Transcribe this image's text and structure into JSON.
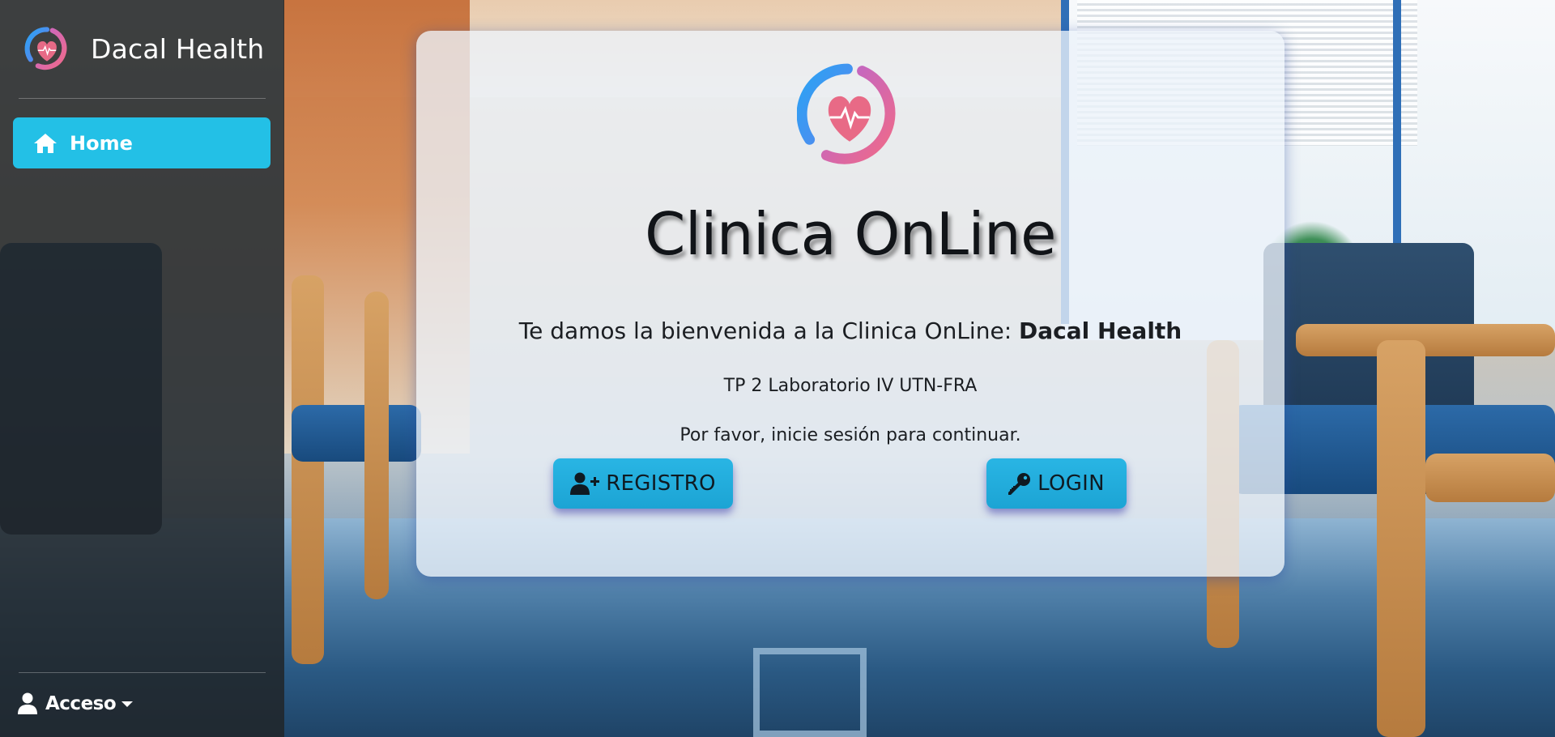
{
  "sidebar": {
    "brand_name": "Dacal Health",
    "nav": [
      {
        "label": "Home",
        "icon": "home-icon",
        "active": true
      }
    ],
    "account": {
      "label": "Acceso",
      "icon": "user-icon"
    }
  },
  "card": {
    "title": "Clinica OnLine",
    "welcome_prefix": "Te damos la bienvenida a la Clinica OnLine: ",
    "welcome_brand": "Dacal Health",
    "subtitle": "TP 2 Laboratorio IV UTN-FRA",
    "instruction": "Por favor, inicie sesión para continuar.",
    "buttons": {
      "register": {
        "label": "REGISTRO",
        "icon": "user-plus-icon"
      },
      "login": {
        "label": "LOGIN",
        "icon": "key-icon"
      }
    }
  },
  "colors": {
    "sidebar_bg": "#212529",
    "accent": "#23c0e6",
    "button_bg": "#1ca4d4",
    "logo_blue": "#2a9df4",
    "logo_pink": "#e86a8e"
  }
}
